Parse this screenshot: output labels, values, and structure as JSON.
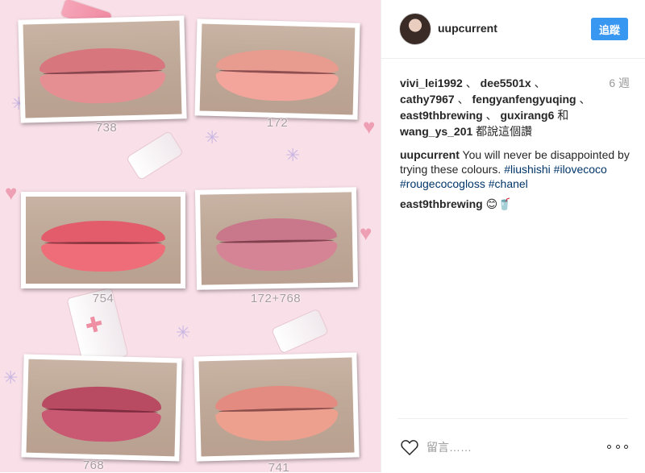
{
  "photo": {
    "swatches": [
      {
        "label": "738",
        "color_top": "#d8767e",
        "color_bottom": "#e58f93"
      },
      {
        "label": "172",
        "color_top": "#e89b8f",
        "color_bottom": "#f3a59c"
      },
      {
        "label": "754",
        "color_top": "#e25c6b",
        "color_bottom": "#ee6d78"
      },
      {
        "label": "172+768",
        "color_top": "#c8788a",
        "color_bottom": "#d58496"
      },
      {
        "label": "768",
        "color_top": "#b84a62",
        "color_bottom": "#c95872"
      },
      {
        "label": "741",
        "color_top": "#e38b80",
        "color_bottom": "#eea08f"
      }
    ],
    "background_color": "#f9dfe7"
  },
  "post": {
    "author": "uupcurrent",
    "follow_label": "追蹤",
    "likes": {
      "users": [
        "vivi_lei1992",
        "dee5501x",
        "cathy7967",
        "fengyanfengyuqing",
        "east9thbrewing",
        "guxirang6",
        "wang_ys_201"
      ],
      "separator": " 、 ",
      "and_text": " 和 ",
      "suffix": " 都說這個讚"
    },
    "time_ago": "6 週",
    "caption": {
      "username": "uupcurrent",
      "text": "You will never be disappointed by trying these colours.",
      "hashtags": [
        "#liushishi",
        "#ilovecoco",
        "#rougecocogloss",
        "#chanel"
      ]
    },
    "comments": [
      {
        "username": "east9thbrewing",
        "text": "😊🥤"
      }
    ],
    "comment_placeholder": "留言……"
  },
  "colors": {
    "accent": "#3897f0",
    "hashtag": "#003569",
    "muted": "#999999"
  }
}
